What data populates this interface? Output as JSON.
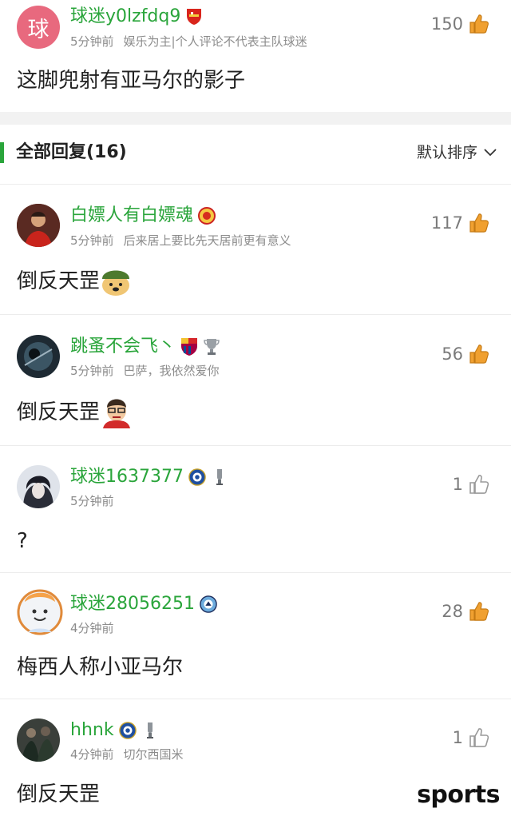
{
  "top_comment": {
    "avatar_char": "球",
    "username": "球迷y0lzfdq9",
    "time": "5分钟前",
    "disclaimer": "娱乐为主|个人评论不代表主队球迷",
    "likes": "150",
    "text": "这脚兜射有亚马尔的影子"
  },
  "replies_header": {
    "title": "全部回复(16)",
    "sort_label": "默认排序"
  },
  "replies": [
    {
      "username": "白嫖人有白嫖魂",
      "time": "5分钟前",
      "signature": "后来居上要比先天居前更有意义",
      "likes": "117",
      "text": "倒反天罡"
    },
    {
      "username": "跳蚤不会飞丶",
      "time": "5分钟前",
      "signature": "巴萨，我依然爱你",
      "likes": "56",
      "text": "倒反天罡"
    },
    {
      "username": "球迷1637377",
      "time": "5分钟前",
      "signature": "",
      "likes": "1",
      "text": "?"
    },
    {
      "username": "球迷28056251",
      "time": "4分钟前",
      "signature": "",
      "likes": "28",
      "text": "梅西人称小亚马尔"
    },
    {
      "username": "hhnk",
      "time": "4分钟前",
      "signature": "切尔西国米",
      "likes": "1",
      "text": "倒反天罡"
    }
  ],
  "colors": {
    "accent": "#2aa53b",
    "like_orange": "#f0a030",
    "like_gray": "#9a9a9a"
  },
  "watermark": {
    "brand": "sports"
  }
}
